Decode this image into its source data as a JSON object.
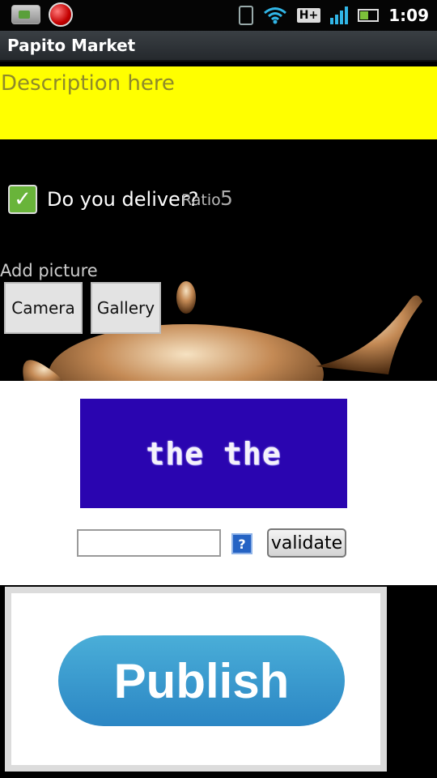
{
  "status_bar": {
    "time": "1:09",
    "network_type": "H+",
    "icons": [
      "photo-icon",
      "globe-notification-icon",
      "vibrate-icon",
      "wifi-icon",
      "network-type-icon",
      "signal-icon",
      "battery-icon"
    ]
  },
  "app": {
    "title": "Papito Market"
  },
  "form": {
    "description_placeholder": "Description here",
    "deliver_label": "Do you deliver?",
    "deliver_checked": true,
    "ratio_label": "Ratio",
    "ratio_value": "5",
    "add_picture_label": "Add picture",
    "camera_button": "Camera",
    "gallery_button": "Gallery"
  },
  "captcha": {
    "image_text": "the the",
    "input_value": "",
    "help_label": "?",
    "validate_button": "validate"
  },
  "publish": {
    "label": "Publish"
  },
  "colors": {
    "description_bg": "#ffff00",
    "captcha_bg": "#2a05b0",
    "publish_button": "#3a9fd0",
    "checkbox_green": "#69b43a"
  }
}
